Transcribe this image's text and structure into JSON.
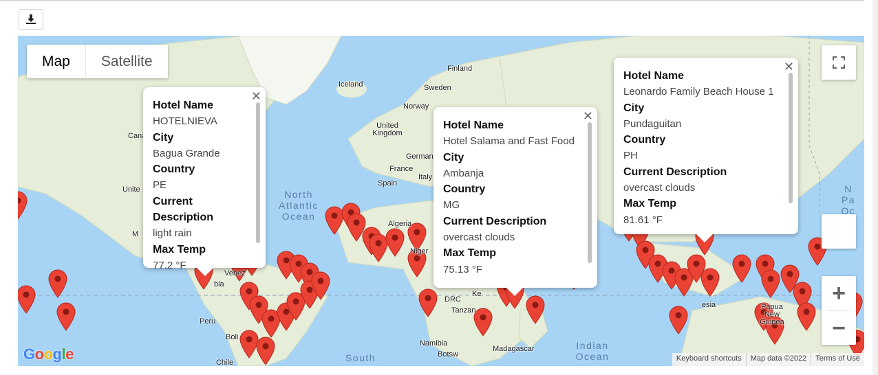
{
  "toolbar": {
    "download_icon": "download-icon"
  },
  "map_type": {
    "map_label": "Map",
    "satellite_label": "Satellite"
  },
  "controls": {
    "zoom_in": "+",
    "zoom_out": "−"
  },
  "labels": {
    "finland": "Finland",
    "iceland": "Iceland",
    "sweden": "Sweden",
    "norway": "Norway",
    "uk": "United Kingdom",
    "germany": "German",
    "france": "France",
    "italy": "Italy",
    "spain": "Spain",
    "algeria": "Algeria",
    "niger": "Niger",
    "drc": "DRC",
    "tanzania": "Tanzan",
    "namibia": "Namibia",
    "botswana": "Botsw",
    "madagascar": "Madagascar",
    "peru": "Peru",
    "bolivia": "Boli",
    "chile": "Chile",
    "venezuela": "Venez",
    "colombia": "bia",
    "canada": "Cana",
    "us": "Unite",
    "mexico": "M",
    "papua": "Papua New Guinea",
    "indonesia": "esia",
    "kenya": "Ke"
  },
  "oceans": {
    "north_atlantic": "North Atlantic Ocean",
    "south_atlantic": "South",
    "indian": "Indian Ocean",
    "pacific_right": "N Pa Oc"
  },
  "attribution": {
    "shortcuts": "Keyboard shortcuts",
    "map_data": "Map data ©2022",
    "terms": "Terms of Use",
    "logo": "Google"
  },
  "popups": [
    {
      "hotel_name_label": "Hotel Name",
      "hotel_name": "HOTELNIEVA",
      "city_label": "City",
      "city": "Bagua Grande",
      "country_label": "Country",
      "country": "PE",
      "desc_label": "Current Description",
      "desc": "light rain",
      "temp_label": "Max Temp",
      "temp": "77.2 °F"
    },
    {
      "hotel_name_label": "Hotel Name",
      "hotel_name": "Hotel Salama and Fast Food",
      "city_label": "City",
      "city": "Ambanja",
      "country_label": "Country",
      "country": "MG",
      "desc_label": "Current Description",
      "desc": "overcast clouds",
      "temp_label": "Max Temp",
      "temp": "75.13 °F"
    },
    {
      "hotel_name_label": "Hotel Name",
      "hotel_name": "Leonardo Family Beach House 1",
      "city_label": "City",
      "city": "Pundaguitan",
      "country_label": "Country",
      "country": "PH",
      "desc_label": "Current Description",
      "desc": "overcast clouds",
      "temp_label": "Max Temp",
      "temp": "81.61 °F"
    }
  ],
  "colors": {
    "marker": "#ea4335",
    "marker_dot": "#8b1a12",
    "water": "#a7d4f5",
    "land": "#e6edd9"
  }
}
